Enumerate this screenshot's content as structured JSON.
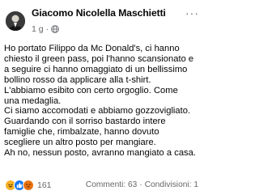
{
  "post": {
    "author": "Giacomo Nicolella Maschietti",
    "time": "1 g",
    "privacy_icon": "globe-icon",
    "more_icon": "more-options-icon",
    "body_lines": [
      "Ho portato Filippo da Mc Donald's, ci hanno",
      "chiesto il green pass, poi l'hanno scansionato e",
      "a seguire ci hanno omaggiato di un bellissimo",
      "bollino rosso da applicare alla t-shirt.",
      "L'abbiamo esibito con certo orgoglio. Come",
      "una medaglia.",
      "Ci siamo accomodati e abbiamo gozzovigliato.",
      "Guardando con il sorriso bastardo intere",
      "famiglie che, rimbalzate, hanno dovuto",
      "scegliere un altro posto per mangiare.",
      "Ah no, nessun posto, avranno mangiato a casa."
    ]
  },
  "footer": {
    "reaction_icons": [
      "haha-reaction-icon",
      "like-reaction-icon",
      "angry-reaction-icon"
    ],
    "reaction_count": "161",
    "comments": "Commenti: 63",
    "shares": "Condivisioni: 1"
  }
}
